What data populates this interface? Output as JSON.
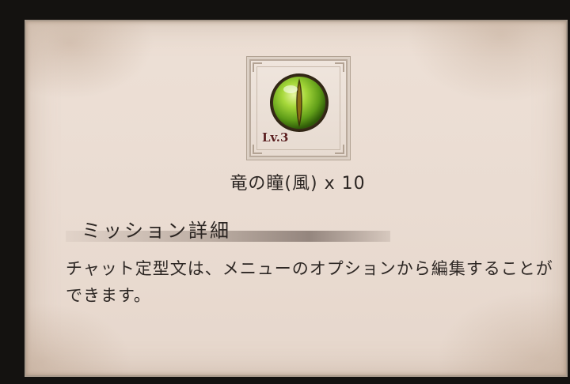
{
  "item": {
    "level": "Lv.3",
    "name": "竜の瞳(風) x 10",
    "icon": "dragon-eye-wind-orb",
    "colors": {
      "orb": "#8fcf2a",
      "pupil": "#3a2a08"
    }
  },
  "mission": {
    "title": "ミッション詳細",
    "description": "チャット定型文は、メニューのオプションから編集することができます。"
  }
}
